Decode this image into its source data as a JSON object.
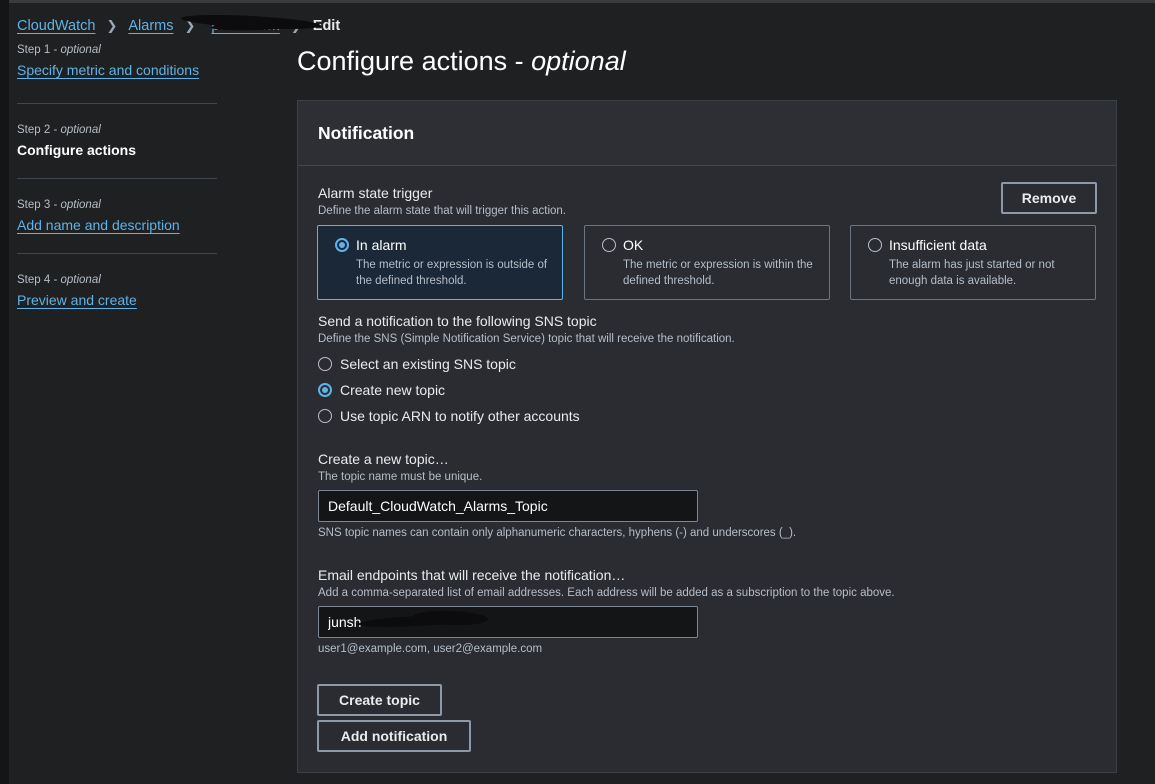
{
  "breadcrumb": {
    "cloudwatch": "CloudWatch",
    "alarms": "Alarms",
    "alarm_name_visible": "p………rm",
    "current": "Edit"
  },
  "steps": [
    {
      "label": "Step 1",
      "optional": "optional",
      "title": "Specify metric and conditions",
      "current": false
    },
    {
      "label": "Step 2",
      "optional": "optional",
      "title": "Configure actions",
      "current": true
    },
    {
      "label": "Step 3",
      "optional": "optional",
      "title": "Add name and description",
      "current": false
    },
    {
      "label": "Step 4",
      "optional": "optional",
      "title": "Preview and create",
      "current": false
    }
  ],
  "page": {
    "title": "Configure actions - ",
    "title_italic": "optional"
  },
  "notification": {
    "heading": "Notification",
    "remove_label": "Remove",
    "trigger": {
      "label": "Alarm state trigger",
      "description": "Define the alarm state that will trigger this action.",
      "options": [
        {
          "title": "In alarm",
          "desc": "The metric or expression is outside of the defined threshold.",
          "selected": true
        },
        {
          "title": "OK",
          "desc": "The metric or expression is within the defined threshold.",
          "selected": false
        },
        {
          "title": "Insufficient data",
          "desc": "The alarm has just started or not enough data is available.",
          "selected": false
        }
      ]
    },
    "sns": {
      "label": "Send a notification to the following SNS topic",
      "description": "Define the SNS (Simple Notification Service) topic that will receive the notification.",
      "options": [
        {
          "label": "Select an existing SNS topic",
          "selected": false
        },
        {
          "label": "Create new topic",
          "selected": true
        },
        {
          "label": "Use topic ARN to notify other accounts",
          "selected": false
        }
      ]
    },
    "new_topic": {
      "label": "Create a new topic…",
      "description": "The topic name must be unique.",
      "value": "Default_CloudWatch_Alarms_Topic",
      "constraint": "SNS topic names can contain only alphanumeric characters, hyphens (-) and underscores (_)."
    },
    "email": {
      "label": "Email endpoints that will receive the notification…",
      "description": "Add a comma-separated list of email addresses. Each address will be added as a subscription to the topic above.",
      "value_visible": "junsh",
      "hint": "user1@example.com, user2@example.com"
    },
    "create_topic_label": "Create topic",
    "add_notification_label": "Add notification"
  },
  "colors": {
    "background": "#1f2022",
    "panel": "#2a2c31",
    "link": "#5fb3e8",
    "selected_tile": "#1a2837"
  }
}
